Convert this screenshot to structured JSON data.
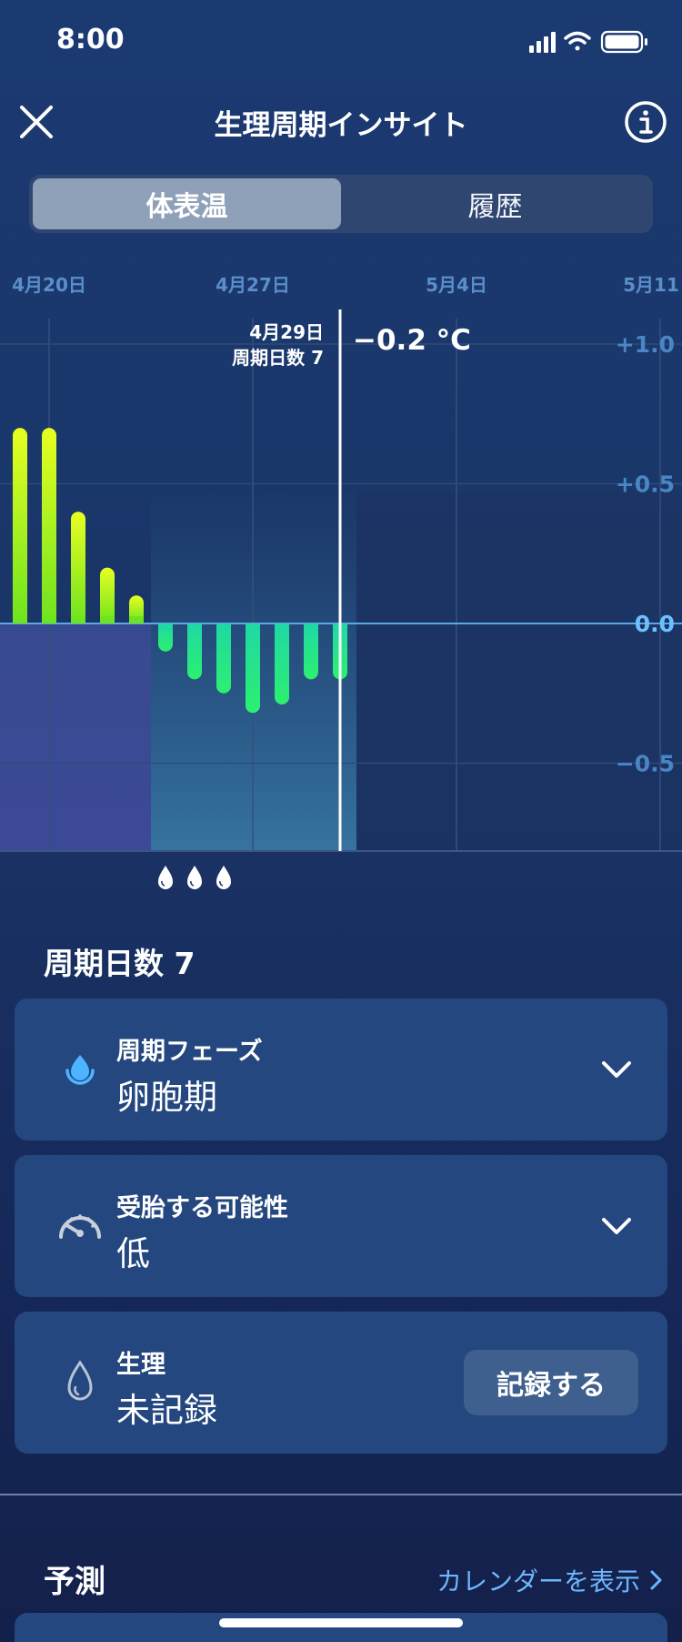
{
  "status_bar": {
    "time": "8:00"
  },
  "nav": {
    "title": "生理周期インサイト"
  },
  "tabs": [
    {
      "label": "体表温",
      "active": true
    },
    {
      "label": "履歴",
      "active": false
    }
  ],
  "chart_data": {
    "type": "bar",
    "x_tick_labels": [
      "4月20日",
      "4月27日",
      "5月4日",
      "5月11日"
    ],
    "y_tick_labels": [
      "+1.0",
      "+0.5",
      "0.0",
      "−0.5"
    ],
    "ylim": [
      -0.9,
      1.1
    ],
    "values": [
      0.7,
      0.7,
      0.4,
      0.2,
      0.1,
      -0.1,
      -0.2,
      -0.25,
      -0.32,
      -0.29,
      -0.2,
      -0.2
    ],
    "selected": {
      "date": "4月29日",
      "cycle_day": "周期日数 7",
      "value_label": "−0.2 °C"
    },
    "period_markers": 3,
    "colors": {
      "positive": "#c8f020",
      "negative": "#22e090",
      "zero_line": "#5aa9e6"
    }
  },
  "cycle_day_title": "周期日数 7",
  "cards": {
    "phase": {
      "label": "周期フェーズ",
      "value": "卵胞期",
      "icon": "drop-icon"
    },
    "fertility": {
      "label": "受胎する可能性",
      "value": "低",
      "icon": "gauge-icon"
    },
    "period": {
      "label": "生理",
      "value": "未記録",
      "button": "記録する",
      "icon": "drop-outline-icon"
    }
  },
  "prediction": {
    "title": "予測",
    "link": "カレンダーを表示"
  }
}
